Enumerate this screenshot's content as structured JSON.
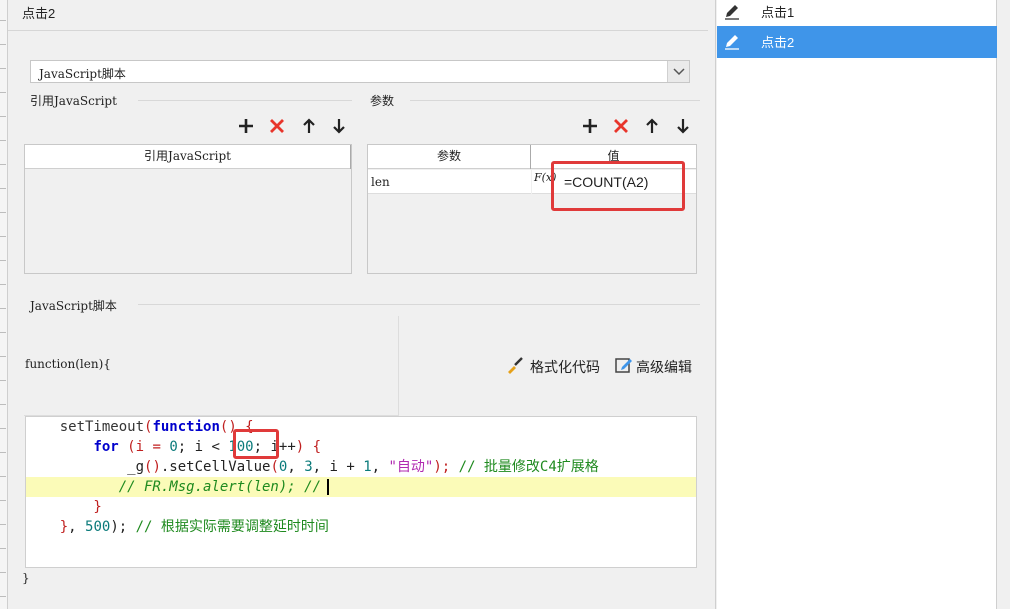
{
  "editor": {
    "title": "点击2",
    "script_type_select": {
      "value": "JavaScript脚本"
    },
    "ref_js_group": {
      "label": "引用JavaScript",
      "column_header": "引用JavaScript"
    },
    "params_group": {
      "label": "参数",
      "headers": [
        "参数",
        "值"
      ],
      "rows": [
        {
          "name": "len",
          "formula_icon": "F(x)",
          "value": "=COUNT(A2)"
        }
      ]
    },
    "script_group": {
      "label": "JavaScript脚本",
      "function_header": "function(len){",
      "format_code_label": "格式化代码",
      "advanced_edit_label": "高级编辑",
      "closing_brace": "}"
    },
    "code": {
      "l1_a": "    setTimeout",
      "l1_b": "(",
      "l1_c": "function",
      "l1_d": "() {",
      "l2_a": "        ",
      "l2_b": "for",
      "l2_c": " (i = ",
      "l2_d": "0",
      "l2_e": "; i < ",
      "l2_f": "100",
      "l2_g": "; i++",
      "l2_h": ") {",
      "l3_a": "            _g",
      "l3_b": "()",
      "l3_c": ".setCellValue",
      "l3_d": "(",
      "l3_e": "0",
      "l3_f": ", ",
      "l3_g": "3",
      "l3_h": ", i + ",
      "l3_i": "1",
      "l3_j": ", ",
      "l3_k": "\"自动\"",
      "l3_l": ");",
      "l3_m": " // 批量修改C4扩展格",
      "l4": "           // FR.Msg.alert(len); //",
      "l5": "        }",
      "l6_a": "    }",
      "l6_b": ", ",
      "l6_c": "500",
      "l6_d": ");",
      "l6_e": " // 根据实际需要调整延时时间"
    }
  },
  "right_panel": {
    "items": [
      {
        "label": "点击1",
        "icon": "pencil-icon",
        "active": false
      },
      {
        "label": "点击2",
        "icon": "pencil-icon",
        "active": true
      }
    ]
  },
  "colors": {
    "accent": "#3f95e9",
    "highlight_box": "#e03a3a",
    "add_icon": "#222222",
    "delete_icon": "#e8352b"
  }
}
